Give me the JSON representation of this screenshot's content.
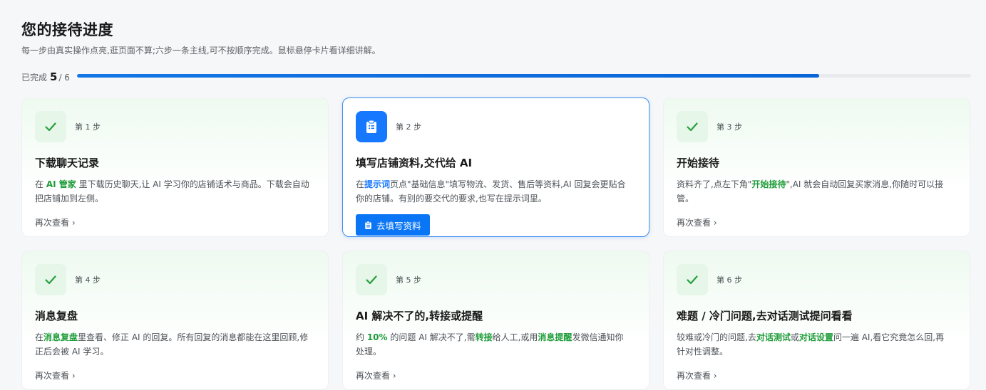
{
  "header": {
    "title": "您的接待进度",
    "subtitle": "每一步由真实操作点亮,逛页面不算;六步一条主线,可不按顺序完成。鼠标悬停卡片看详细讲解。"
  },
  "progress": {
    "label": "已完成",
    "done": "5",
    "total": "/ 6",
    "fraction": 0.83
  },
  "colors": {
    "accent_blue": "#1677ff",
    "accent_green": "#1f9d3a",
    "done_badge_bg": "#e6f6e8"
  },
  "cards": [
    {
      "step": "第 1 步",
      "icon": "check-icon",
      "title": "下载聊天记录",
      "desc": [
        {
          "t": "在 "
        },
        {
          "t": "AI 管家",
          "hl": "green"
        },
        {
          "t": " 里下载历史聊天,让 AI 学习你的店铺话术与商品。下载会自动把店铺加到左侧。"
        }
      ],
      "link": "再次查看 ›"
    },
    {
      "step": "第 2 步",
      "icon": "clipboard-icon",
      "title": "填写店铺资料,交代给 AI",
      "desc": [
        {
          "t": "在"
        },
        {
          "t": "提示词",
          "hl": "blue"
        },
        {
          "t": "页点\"基础信息\"填写物流、发货、售后等资料,AI 回复会更贴合你的店铺。有别的要交代的要求,也写在提示词里。"
        }
      ],
      "button": "去填写资料",
      "active": true
    },
    {
      "step": "第 3 步",
      "icon": "check-icon",
      "title": "开始接待",
      "desc": [
        {
          "t": "资料齐了,点左下角\""
        },
        {
          "t": "开始接待",
          "hl": "green"
        },
        {
          "t": "\",AI 就会自动回复买家消息,你随时可以接管。"
        }
      ],
      "link": "再次查看 ›"
    },
    {
      "step": "第 4 步",
      "icon": "check-icon",
      "title": "消息复盘",
      "desc": [
        {
          "t": "在"
        },
        {
          "t": "消息复盘",
          "hl": "green"
        },
        {
          "t": "里查看、修正 AI 的回复。所有回复的消息都能在这里回顾,修正后会被 AI 学习。"
        }
      ],
      "link": "再次查看 ›"
    },
    {
      "step": "第 5 步",
      "icon": "check-icon",
      "title": "AI 解决不了的,转接或提醒",
      "desc": [
        {
          "t": "约 "
        },
        {
          "t": "10%",
          "hl": "green"
        },
        {
          "t": " 的问题 AI 解决不了,需"
        },
        {
          "t": "转接",
          "hl": "green"
        },
        {
          "t": "给人工,或用"
        },
        {
          "t": "消息提醒",
          "hl": "green"
        },
        {
          "t": "发微信通知你处理。"
        }
      ],
      "link": "再次查看 ›"
    },
    {
      "step": "第 6 步",
      "icon": "check-icon",
      "title": "难题 / 冷门问题,去对话测试提问看看",
      "desc": [
        {
          "t": "较难或冷门的问题,去"
        },
        {
          "t": "对话测试",
          "hl": "green"
        },
        {
          "t": "或"
        },
        {
          "t": "对话设置",
          "hl": "green"
        },
        {
          "t": "问一遍 AI,看它究竟怎么回,再针对性调整。"
        }
      ],
      "link": "再次查看 ›"
    }
  ]
}
